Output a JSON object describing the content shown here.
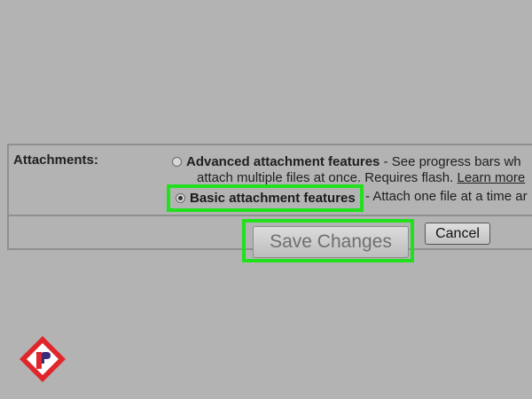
{
  "attachments": {
    "label": "Attachments:",
    "advanced": {
      "title": "Advanced attachment features",
      "desc": " - See progress bars wh",
      "line2": "attach multiple files at once. Requires flash. ",
      "learn_more": "Learn more",
      "selected": false
    },
    "basic": {
      "title": "Basic attachment features",
      "desc": " - Attach one file at a time ar",
      "selected": true
    }
  },
  "actions": {
    "save_label": "Save Changes",
    "cancel_label": "Cancel"
  },
  "colors": {
    "background": "#b3b3b3",
    "highlight": "#22e01e",
    "logo_red": "#e0262b"
  },
  "icons": {
    "logo": "logo-r-diamond-icon"
  }
}
